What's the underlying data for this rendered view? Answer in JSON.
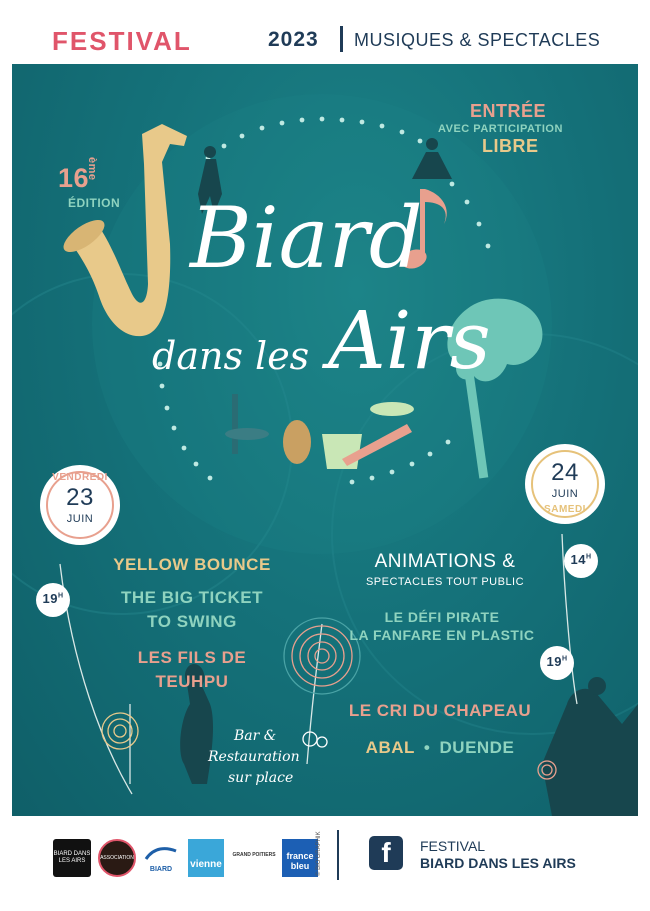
{
  "colors": {
    "coral": "#e0556a",
    "navy": "#1f3b57",
    "teal": "#17767d",
    "gold": "#e8c98a",
    "pink": "#e8a08e",
    "mint": "#8fd3bf",
    "white": "#ffffff",
    "date_ring": "#ee9b8a",
    "date_ring2": "#e6c27a"
  },
  "header": {
    "festival": "FESTIVAL",
    "year": "2023",
    "subtitle": "MUSIQUES & SPECTACLES"
  },
  "poster": {
    "edition_number": "16",
    "edition_suffix": "ème",
    "edition_label": "ÉDITION",
    "entry_line1": "ENTRÉE",
    "entry_line2": "AVEC PARTICIPATION",
    "entry_line3": "LIBRE",
    "title_word1": "Biard",
    "title_word2": "dans les",
    "title_word3": "Airs",
    "day1": {
      "weekday": "VENDREDI",
      "day": "23",
      "month": "JUIN"
    },
    "day2": {
      "weekday": "SAMEDI",
      "day": "24",
      "month": "JUIN"
    },
    "time_fri": "19",
    "time_sat_a": "14",
    "time_sat_b": "19",
    "time_unit": "H",
    "friday_acts": [
      "YELLOW BOUNCE",
      "THE BIG TICKET",
      "TO SWING",
      "LES FILS DE",
      "TEUHPU"
    ],
    "animations_title": "ANIMATIONS &",
    "animations_sub": "SPECTACLES TOUT PUBLIC",
    "animations_acts": [
      "LE DÉFI PIRATE",
      "LA FANFARE EN PLASTIC"
    ],
    "saturday_acts": [
      "LE CRI DU CHAPEAU",
      "ABAL",
      "•",
      "DUENDE"
    ],
    "bar_line1": "Bar &",
    "bar_line2": "Restauration",
    "bar_line3": "sur place"
  },
  "footer": {
    "logos": [
      "BIARD DANS LES AIRS",
      "ASSOCIATION",
      "BIARD",
      "vienne",
      "GRAND POITIERS",
      "france bleu"
    ],
    "credit": "© BIO'GRAPHIK",
    "fb_icon": "facebook-icon",
    "fb_letter": "f",
    "fb_line1": "FESTIVAL",
    "fb_line2": "BIARD DANS LES AIRS"
  }
}
